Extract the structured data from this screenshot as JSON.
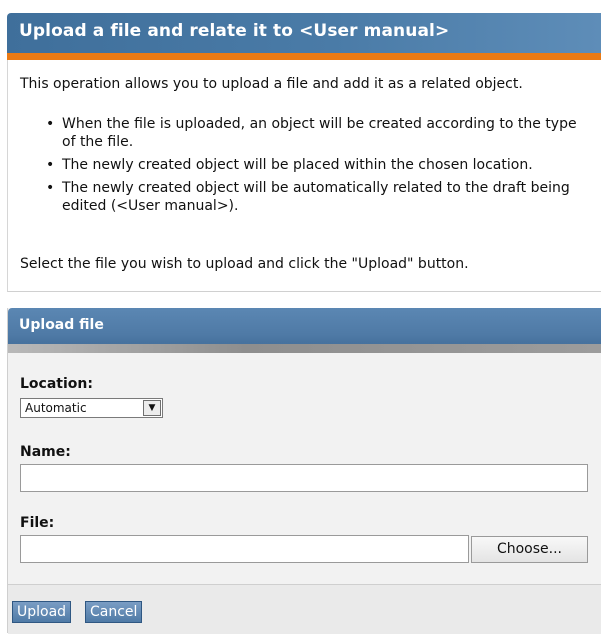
{
  "header": {
    "title": "Upload a file and relate it to <User manual>",
    "accent_color": "#ea7a14",
    "bar_color": "#4a7ba7"
  },
  "intro": {
    "text": "This operation allows you to upload a file and add it as a related object.",
    "bullets": [
      "When the file is uploaded, an object will be created according to the type of the file.",
      "The newly created object will be placed within the chosen location.",
      "The newly created object will be automatically related to the draft being edited (<User manual>)."
    ],
    "instruction": "Select the file you wish to upload and click the \"Upload\" button."
  },
  "form": {
    "title": "Upload file",
    "location": {
      "label": "Location:",
      "value": "Automatic"
    },
    "name": {
      "label": "Name:",
      "value": ""
    },
    "file": {
      "label": "File:",
      "value": "",
      "choose_label": "Choose..."
    }
  },
  "buttons": {
    "upload": "Upload",
    "cancel": "Cancel"
  }
}
